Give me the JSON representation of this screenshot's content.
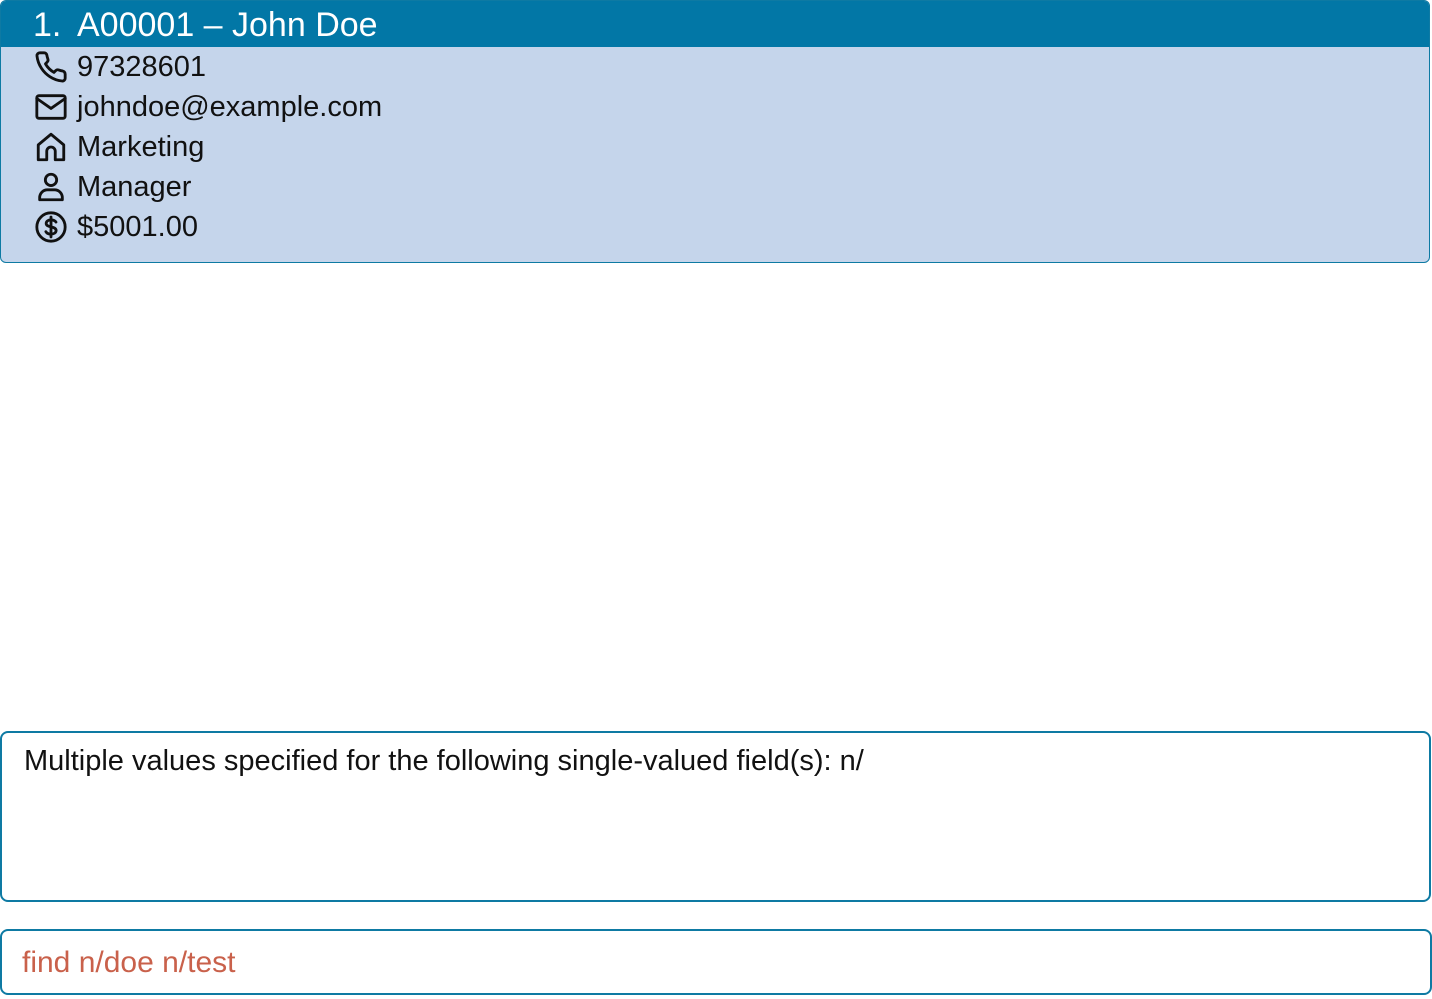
{
  "person_card": {
    "index": "1.",
    "title": "A00001 – John Doe",
    "fields": [
      {
        "icon": "phone-icon",
        "value": "97328601"
      },
      {
        "icon": "email-icon",
        "value": "johndoe@example.com"
      },
      {
        "icon": "department-icon",
        "value": "Marketing"
      },
      {
        "icon": "role-icon",
        "value": "Manager"
      },
      {
        "icon": "salary-icon",
        "value": "$5001.00"
      }
    ],
    "colors": {
      "header_bg": "#0277a6",
      "card_bg": "#c5d5eb",
      "border": "#0e7aa3"
    }
  },
  "result_display": {
    "text": "Multiple values specified for the following single-valued field(s): n/"
  },
  "command_box": {
    "value": "find n/doe n/test",
    "text_color": "#c9614b"
  }
}
